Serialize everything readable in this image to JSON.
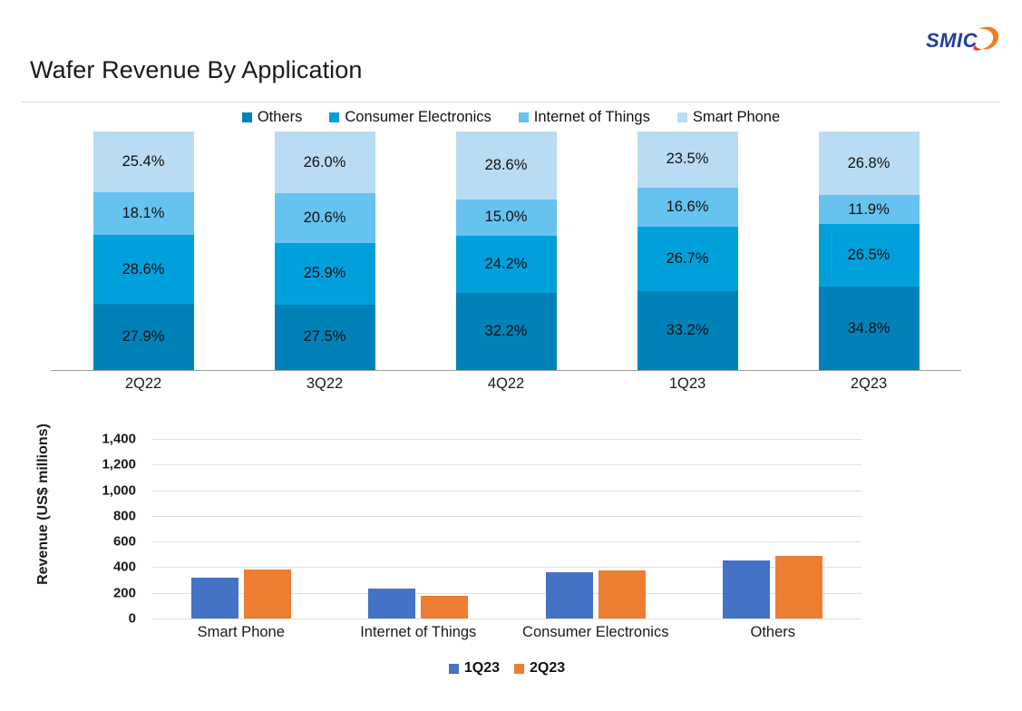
{
  "logo": {
    "wordmark": "SMIC",
    "blue": "#1f3f9e",
    "orange": "#f47b20"
  },
  "title": "Wafer Revenue By Application",
  "colors": {
    "others": "#0081b8",
    "consumer_electronics": "#00a0dd",
    "internet_of_things": "#66c2ef",
    "smart_phone": "#b9dcf4",
    "q1_23": "#4472c4",
    "q2_23": "#ed7d31",
    "gridline": "#e0e0e0",
    "axis": "#9c9c9c"
  },
  "chart_data": [
    {
      "type": "bar",
      "stacked": true,
      "title": "Wafer Revenue By Application",
      "xlabel": "",
      "ylabel": "",
      "grid": false,
      "legend_position": "top",
      "categories": [
        "2Q22",
        "3Q22",
        "4Q22",
        "1Q23",
        "2Q23"
      ],
      "legend": [
        "Others",
        "Consumer Electronics",
        "Internet of Things",
        "Smart Phone"
      ],
      "series": [
        {
          "name": "Smart Phone",
          "color": "#b9dcf4",
          "values": [
            25.4,
            26.0,
            28.6,
            23.5,
            26.8
          ],
          "labels": [
            "25.4%",
            "26.0%",
            "28.6%",
            "23.5%",
            "26.8%"
          ]
        },
        {
          "name": "Internet of Things",
          "color": "#66c2ef",
          "values": [
            18.1,
            20.6,
            15.0,
            16.6,
            11.9
          ],
          "labels": [
            "18.1%",
            "20.6%",
            "15.0%",
            "16.6%",
            "11.9%"
          ]
        },
        {
          "name": "Consumer Electronics",
          "color": "#00a0dd",
          "values": [
            28.6,
            25.9,
            24.2,
            26.7,
            26.5
          ],
          "labels": [
            "28.6%",
            "25.9%",
            "24.2%",
            "26.7%",
            "26.5%"
          ]
        },
        {
          "name": "Others",
          "color": "#0081b8",
          "values": [
            27.9,
            27.5,
            32.2,
            33.2,
            34.8
          ],
          "labels": [
            "27.9%",
            "27.5%",
            "32.2%",
            "33.2%",
            "34.8%"
          ]
        }
      ],
      "unit": "%"
    },
    {
      "type": "bar",
      "stacked": false,
      "title": "",
      "xlabel": "",
      "ylabel": "Revenue (US$  millions)",
      "grid": true,
      "legend_position": "bottom",
      "ylim": [
        0,
        1400
      ],
      "ytick_labels": [
        "1,400",
        "1,200",
        "1,000",
        "800",
        "600",
        "400",
        "200",
        "0"
      ],
      "ytick_values": [
        1400,
        1200,
        1000,
        800,
        600,
        400,
        200,
        0
      ],
      "categories": [
        "Smart Phone",
        "Internet of Things",
        "Consumer Electronics",
        "Others"
      ],
      "legend": [
        "1Q23",
        "2Q23"
      ],
      "series": [
        {
          "name": "1Q23",
          "color": "#4472c4",
          "values": [
            320,
            230,
            360,
            450
          ]
        },
        {
          "name": "2Q23",
          "color": "#ed7d31",
          "values": [
            380,
            175,
            375,
            490
          ]
        }
      ]
    }
  ]
}
